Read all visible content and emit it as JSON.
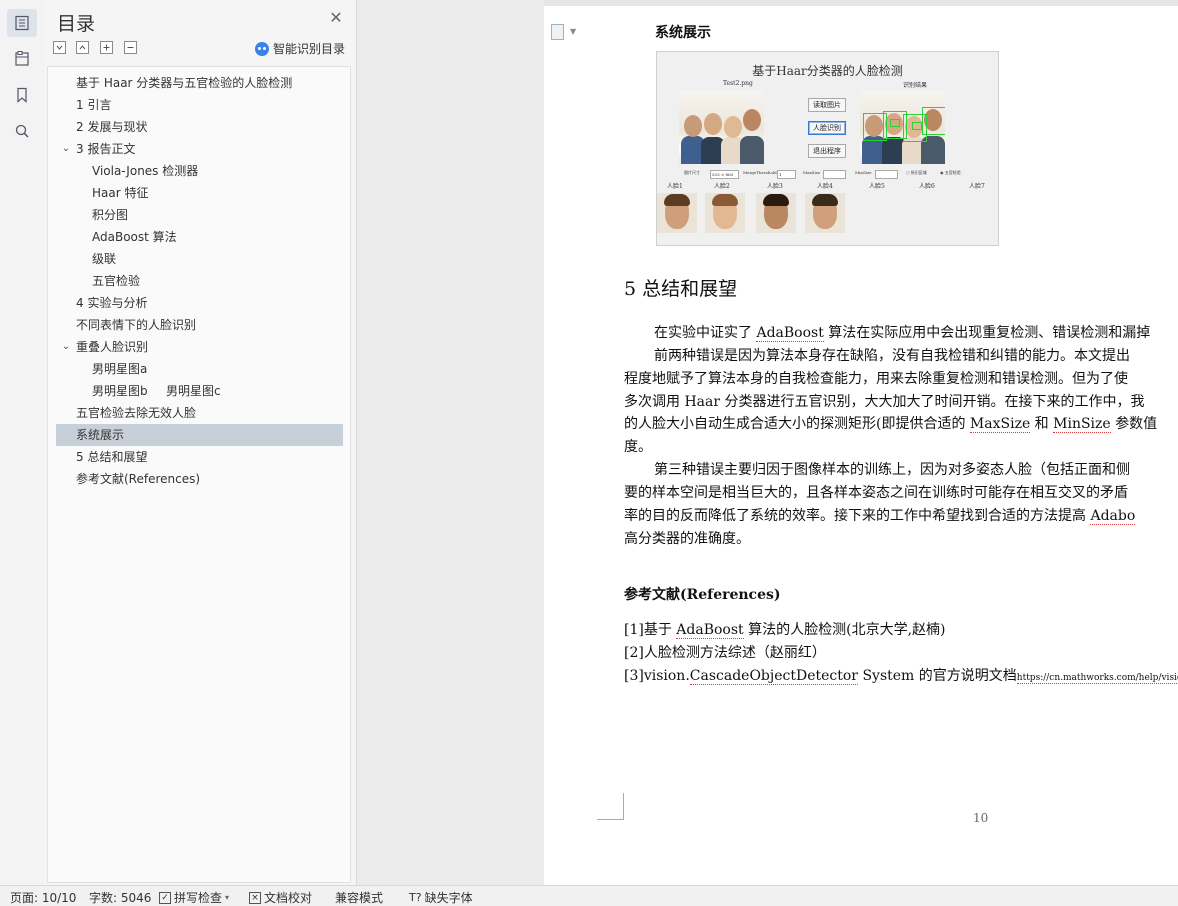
{
  "sidebar_rail": {
    "icons": [
      "toc-icon",
      "navigation-icon",
      "bookmark-icon",
      "search-icon"
    ]
  },
  "toc": {
    "title": "目录",
    "smart_label": "智能识别目录",
    "items": [
      {
        "label": "基于 Haar 分类器与五官检验的人脸检测",
        "level": 1,
        "expanded": false
      },
      {
        "label": "1  引言",
        "level": 1
      },
      {
        "label": "2  发展与现状",
        "level": 1
      },
      {
        "label": "3 报告正文",
        "level": 1,
        "expanded": true
      },
      {
        "label": "Viola-Jones 检测器",
        "level": 2
      },
      {
        "label": "Haar 特征",
        "level": 2
      },
      {
        "label": "积分图",
        "level": 2
      },
      {
        "label": "AdaBoost 算法",
        "level": 2
      },
      {
        "label": "级联",
        "level": 2
      },
      {
        "label": "五官检验",
        "level": 2
      },
      {
        "label": "4 实验与分析",
        "level": 1
      },
      {
        "label": "不同表情下的人脸识别",
        "level": 1
      },
      {
        "label": "重叠人脸识别",
        "level": 1,
        "expanded": true
      },
      {
        "label": "男明星图a",
        "level": 2
      },
      {
        "label": "男明星图b",
        "level": 2,
        "extra": "男明星图c"
      },
      {
        "label": "五官检验去除无效人脸",
        "level": 1
      },
      {
        "label": "系统展示",
        "level": 1,
        "selected": true
      },
      {
        "label": "5  总结和展望",
        "level": 1
      },
      {
        "label": "参考文献(References)",
        "level": 1
      }
    ]
  },
  "document": {
    "section_heading": "系统展示",
    "figure": {
      "title": "基于Haar分类器的人脸检测",
      "left_caption": "Test2.png",
      "right_caption": "识别结果",
      "buttons": [
        "读取图片",
        "人脸识别",
        "退出程序"
      ],
      "params": {
        "size_label": "图片尺寸",
        "size_value": "533 × 863",
        "merge_label": "MergeThreshold",
        "merge_value": "1",
        "max_label": "MaxSize",
        "min_label": "MinSize",
        "opt1": "所识区域",
        "opt2": "五官检验"
      },
      "face_labels": [
        "人脸1",
        "人脸2",
        "人脸3",
        "人脸4",
        "人脸5",
        "人脸6",
        "人脸7"
      ]
    },
    "chapter_heading": "5  总结和展望",
    "p1_line1_pre": "在实验中证实了 ",
    "p1_line1_word": "AdaBoost",
    "p1_line1_post": " 算法在实际应用中会出现重复检测、错误检测和漏掉",
    "p2_line1": "前两种错误是因为算法本身存在缺陷，没有自我检错和纠错的能力。本文提出",
    "p2_line2": "程度地赋予了算法本身的自我检查能力，用来去除重复检测和错误检测。但为了使",
    "p2_line3": "多次调用 Haar 分类器进行五官识别，大大加大了时间开销。在接下来的工作中，我",
    "p2_line4_pre": "的人脸大小自动生成合适大小的探测矩形(即提供合适的 ",
    "p2_line4_w1": "MaxSize",
    "p2_line4_mid": " 和 ",
    "p2_line4_w2": "MinSize",
    "p2_line4_post": " 参数值",
    "p2_line5": "度。",
    "p3_line1": "第三种错误主要归因于图像样本的训练上，因为对多姿态人脸（包括正面和侧",
    "p3_line2": "要的样本空间是相当巨大的，且各样本姿态之间在训练时可能存在相互交叉的矛盾",
    "p3_line3_pre": "率的目的反而降低了系统的效率。接下来的工作中希望找到合适的方法提高 ",
    "p3_line3_word": "Adabo",
    "p3_line4": "高分类器的准确度。",
    "ref_heading": "参考文献(References)",
    "ref1_pre": "[1]基于 ",
    "ref1_word": "AdaBoost",
    "ref1_post": " 算法的人脸检测(北京大学,赵楠)",
    "ref2": "[2]人脸检测方法综述（赵丽红）",
    "ref3_pre": "[3]vision.",
    "ref3_word": "CascadeObjectDetector",
    "ref3_post": " System 的官方说明文档",
    "ref3_url": "https://cn.mathworks.com/help/vision/ref/vision.ca",
    "page_number": "10"
  },
  "status": {
    "page": "页面: 10/10",
    "words": "字数: 5046",
    "spell": "拼写检查",
    "proof": "文档校对",
    "compat": "兼容模式",
    "fonts": "缺失字体"
  },
  "colors": {
    "selection": "#c7d0d9",
    "accent": "#3b82e6",
    "squiggle": "#d23b3b"
  }
}
